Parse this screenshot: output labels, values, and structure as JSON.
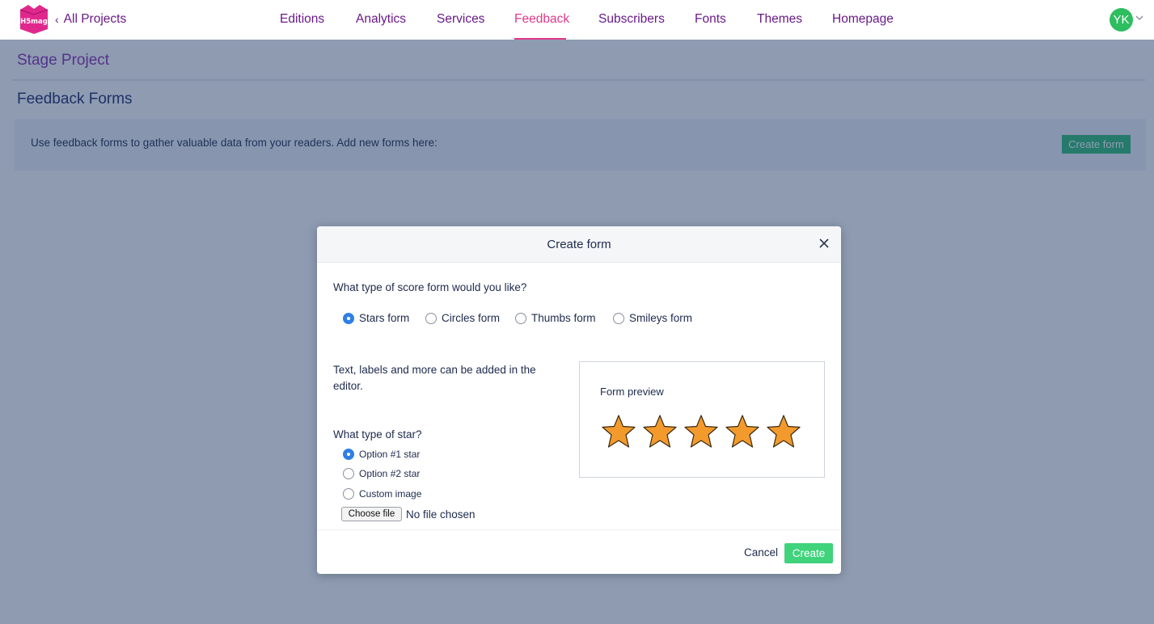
{
  "app": {
    "logo_text": "H5mag",
    "back_link": "All Projects"
  },
  "nav": {
    "items": [
      {
        "label": "Editions"
      },
      {
        "label": "Analytics"
      },
      {
        "label": "Services"
      },
      {
        "label": "Feedback"
      },
      {
        "label": "Subscribers"
      },
      {
        "label": "Fonts"
      },
      {
        "label": "Themes"
      },
      {
        "label": "Homepage"
      }
    ],
    "active": "Feedback"
  },
  "user": {
    "initials": "YK",
    "avatar_color": "#2ebd5f"
  },
  "page": {
    "project_title": "Stage Project",
    "section_title": "Feedback Forms",
    "info_text": "Use feedback forms to gather valuable data from your readers. Add new forms here:",
    "create_form_label": "Create form"
  },
  "modal": {
    "title": "Create form",
    "question_type": "What type of score form would you like?",
    "form_types": [
      {
        "label": "Stars form",
        "checked": true
      },
      {
        "label": "Circles form",
        "checked": false
      },
      {
        "label": "Thumbs form",
        "checked": false
      },
      {
        "label": "Smileys form",
        "checked": false
      }
    ],
    "hint": "Text, labels and more can be added in the editor.",
    "question_star": "What type of star?",
    "star_types": [
      {
        "label": "Option #1 star",
        "checked": true
      },
      {
        "label": "Option #2 star",
        "checked": false
      },
      {
        "label": "Custom image",
        "checked": false
      }
    ],
    "file_button": "Choose file",
    "file_status": "No file chosen",
    "preview_label": "Form preview",
    "preview_star_count": 5,
    "star_color": "#f39a2c",
    "cancel_label": "Cancel",
    "create_label": "Create"
  },
  "colors": {
    "accent": "#e0388a",
    "brand_purple": "#6a1a8a",
    "primary_green": "#3fd37c"
  }
}
